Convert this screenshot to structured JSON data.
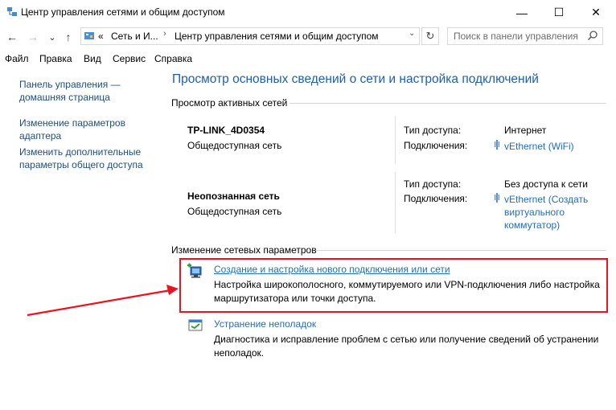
{
  "window": {
    "title": "Центр управления сетями и общим доступом",
    "minimize_glyph": "—",
    "maximize_glyph": "☐",
    "close_glyph": "✕"
  },
  "nav": {
    "back_glyph": "←",
    "forward_glyph": "→",
    "recent_glyph": "⌄",
    "up_glyph": "↑"
  },
  "address": {
    "overflow": "«",
    "crumb1": "Сеть и И...",
    "sep": "›",
    "crumb2": "Центр управления сетями и общим доступом",
    "dropdown_glyph": "⌄",
    "refresh_glyph": "↻"
  },
  "search": {
    "placeholder": "Поиск в панели управления"
  },
  "menu": [
    "Файл",
    "Правка",
    "Вид",
    "Сервис",
    "Справка"
  ],
  "sidebar": {
    "items": [
      {
        "label": "Панель управления — домашняя страница"
      },
      {
        "label": "Изменение параметров адаптера"
      },
      {
        "label": "Изменить дополнительные параметры общего доступа"
      }
    ]
  },
  "main": {
    "heading": "Просмотр основных сведений о сети и настройка подключений",
    "active_label": "Просмотр активных сетей",
    "networks": [
      {
        "name": "TP-LINK_4D0354",
        "category": "Общедоступная сеть",
        "access_key": "Тип доступа:",
        "access_val": "Интернет",
        "conn_key": "Подключения:",
        "conn_val": "vEthernet (WiFi)"
      },
      {
        "name": "Неопознанная сеть",
        "category": "Общедоступная сеть",
        "access_key": "Тип доступа:",
        "access_val": "Без доступа к сети",
        "conn_key": "Подключения:",
        "conn_val": "vEthernet (Создать виртуального коммутатор)"
      }
    ],
    "change_label": "Изменение сетевых параметров",
    "tasks": [
      {
        "title": "Создание и настройка нового подключения или сети",
        "desc": "Настройка широкополосного, коммутируемого или VPN-подключения либо настройка маршрутизатора или точки доступа."
      },
      {
        "title": "Устранение неполадок",
        "desc": "Диагностика и исправление проблем с сетью или получение сведений об устранении неполадок."
      }
    ]
  },
  "colors": {
    "link": "#1e6fbf",
    "heading": "#1e5fae",
    "highlight": "#e8141f"
  }
}
